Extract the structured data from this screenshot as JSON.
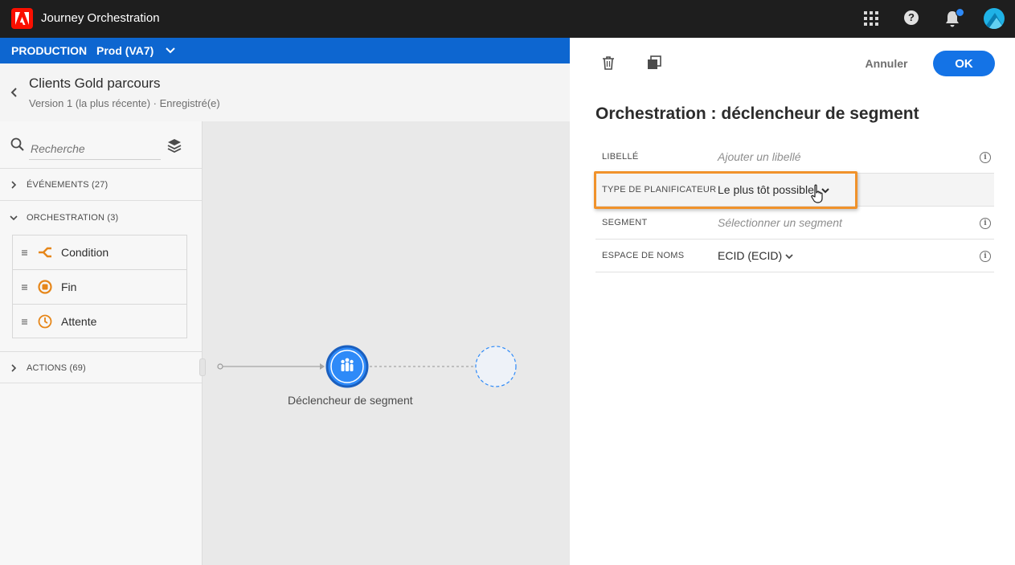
{
  "app": {
    "title": "Journey Orchestration",
    "logo_icon": "adobe-logo-icon"
  },
  "header_icons": [
    "apps-grid-icon",
    "help-icon",
    "notifications-bell-icon",
    "user-avatar"
  ],
  "environment": {
    "label": "PRODUCTION",
    "sandbox": "Prod (VA7)"
  },
  "journey": {
    "title": "Clients Gold parcours",
    "subtitle": "Version 1 (la plus récente) · Enregistré(e)"
  },
  "palette": {
    "search_placeholder": "Recherche",
    "sections": {
      "events": "ÉVÉNEMENTS (27)",
      "orchestration": "ORCHESTRATION (3)",
      "actions": "ACTIONS (69)"
    },
    "orchestration_items": [
      {
        "label": "Condition",
        "icon": "condition-branch-icon"
      },
      {
        "label": "Fin",
        "icon": "end-stop-icon"
      },
      {
        "label": "Attente",
        "icon": "wait-clock-icon"
      }
    ]
  },
  "canvas": {
    "node_label": "Déclencheur de segment",
    "node_icon": "segment-audience-icon"
  },
  "panel": {
    "cancel_label": "Annuler",
    "ok_label": "OK",
    "title": "Orchestration : déclencheur de segment",
    "fields": {
      "libelle": {
        "key": "LIBELLÉ",
        "placeholder": "Ajouter un libellé"
      },
      "type": {
        "key": "TYPE DE PLANIFICATEUR",
        "value": "Le plus tôt possible"
      },
      "segment": {
        "key": "SEGMENT",
        "placeholder": "Sélectionner un segment"
      },
      "espace": {
        "key": "ESPACE DE NOMS",
        "value": "ECID (ECID)"
      }
    }
  },
  "colors": {
    "topbar": "#1e1e1e",
    "env_bar": "#0d66d0",
    "accent": "#1473e6",
    "orchestration_orange": "#e68619",
    "highlight_orange": "#f0922b"
  }
}
